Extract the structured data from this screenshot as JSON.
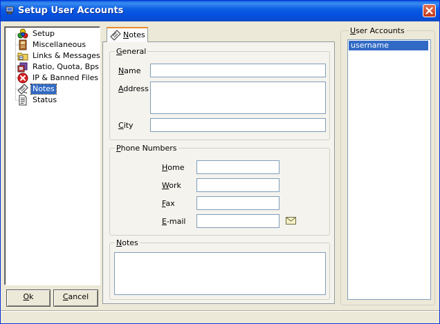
{
  "window": {
    "title": "Setup User Accounts"
  },
  "tree": {
    "items": [
      {
        "label": "Setup",
        "icon": "setup-icon"
      },
      {
        "label": "Miscellaneous",
        "icon": "miscellaneous-icon"
      },
      {
        "label": "Links & Messages",
        "icon": "links-messages-icon"
      },
      {
        "label": "Ratio, Quota, Bps",
        "icon": "ratio-quota-icon"
      },
      {
        "label": "IP & Banned Files",
        "icon": "banned-icon"
      },
      {
        "label": "Notes",
        "icon": "notes-icon",
        "selected": true
      },
      {
        "label": "Status",
        "icon": "status-icon"
      }
    ]
  },
  "buttons": {
    "ok_mnemonic": "O",
    "ok_rest": "k",
    "cancel_mnemonic": "C",
    "cancel_rest": "ancel"
  },
  "tab": {
    "label_mnemonic": "N",
    "label_rest": "otes"
  },
  "general": {
    "title_mnemonic": "G",
    "title_rest": "eneral",
    "name_mnemonic": "N",
    "name_rest": "ame",
    "name_value": "",
    "address_mnemonic": "A",
    "address_rest": "ddress",
    "address_value": "",
    "city_mnemonic": "C",
    "city_rest": "ity",
    "city_value": ""
  },
  "phone": {
    "title_mnemonic": "P",
    "title_rest": "hone Numbers",
    "home_mnemonic": "H",
    "home_rest": "ome",
    "home_value": "",
    "work_mnemonic": "W",
    "work_rest": "ork",
    "work_value": "",
    "fax_mnemonic": "F",
    "fax_rest": "ax",
    "fax_value": "",
    "email_mnemonic": "E",
    "email_rest": "-mail",
    "email_value": "",
    "email_icon": "envelope-icon"
  },
  "notes_group": {
    "title_mnemonic": "N",
    "title_rest": "otes",
    "value": ""
  },
  "user_accounts": {
    "title_mnemonic": "U",
    "title_rest": "ser Accounts",
    "items": [
      "username"
    ],
    "selected_index": 0
  },
  "colors": {
    "selection": "#316ac5",
    "title_bar": "#0450e0",
    "window_bg": "#ece9d8",
    "tab_accent": "#e68b2c"
  }
}
